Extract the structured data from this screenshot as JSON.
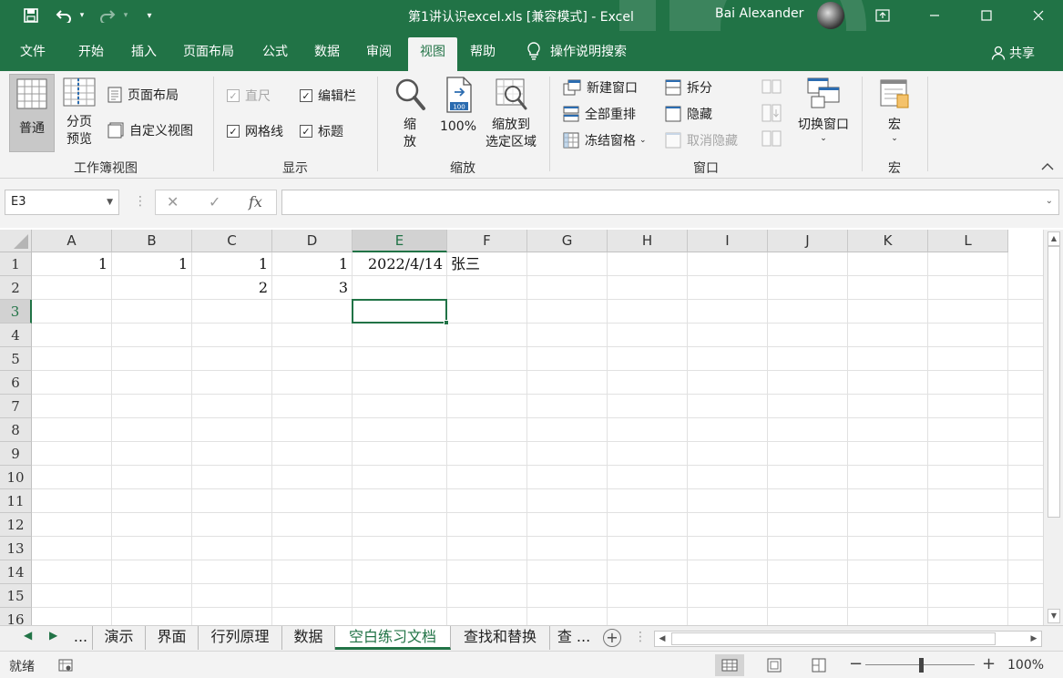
{
  "titlebar": {
    "document_title": "第1讲认识excel.xls  [兼容模式]  -  Excel",
    "user_name": "Bai Alexander",
    "icons": [
      "save-icon",
      "undo-icon",
      "redo-icon",
      "customize-icon",
      "restore-ribbon-icon",
      "minimize-icon",
      "maximize-icon",
      "close-icon"
    ]
  },
  "tabs": {
    "items": [
      "文件",
      "开始",
      "插入",
      "页面布局",
      "公式",
      "数据",
      "审阅",
      "视图",
      "帮助"
    ],
    "active": "视图",
    "tell_me": "操作说明搜索",
    "share": "共享"
  },
  "ribbon": {
    "workbook_views": {
      "label": "工作簿视图",
      "normal": "普通",
      "page_break_1": "分页",
      "page_break_2": "预览",
      "page_layout": "页面布局",
      "custom_views": "自定义视图"
    },
    "show": {
      "label": "显示",
      "ruler": "直尺",
      "formula_bar": "编辑栏",
      "gridlines": "网格线",
      "headings": "标题"
    },
    "zoom": {
      "label": "缩放",
      "zoom_1": "缩",
      "zoom_2": "放",
      "hundred": "100%",
      "zoom_sel_1": "缩放到",
      "zoom_sel_2": "选定区域",
      "icon_number": "100"
    },
    "window": {
      "label": "窗口",
      "new_window": "新建窗口",
      "arrange_all": "全部重排",
      "freeze_panes": "冻结窗格",
      "split": "拆分",
      "hide": "隐藏",
      "unhide": "取消隐藏",
      "switch_windows": "切换窗口"
    },
    "macros": {
      "label": "宏",
      "macros_btn": "宏"
    }
  },
  "formula_bar": {
    "name_box": "E3",
    "cancel": "✕",
    "enter": "✓",
    "fx": "fx",
    "value": ""
  },
  "grid": {
    "columns": [
      "A",
      "B",
      "C",
      "D",
      "E",
      "F",
      "G",
      "H",
      "I",
      "J",
      "K",
      "L"
    ],
    "rows": [
      "1",
      "2",
      "3",
      "4",
      "5",
      "6",
      "7",
      "8",
      "9",
      "10",
      "11",
      "12",
      "13",
      "14",
      "15",
      "16"
    ],
    "selected_cell": "E3",
    "cells": {
      "A1": "1",
      "B1": "1",
      "C1": "1",
      "D1": "1",
      "E1": "2022/4/14",
      "F1": "张三",
      "C2": "2",
      "D2": "3"
    }
  },
  "sheets": {
    "ellipsis": "...",
    "items": [
      "演示",
      "界面",
      "行列原理",
      "数据",
      "空白练习文档",
      "查找和替换",
      "查 ..."
    ],
    "active": "空白练习文档"
  },
  "statusbar": {
    "status": "就绪",
    "zoom": "100%",
    "zoom_minus": "−",
    "zoom_plus": "+"
  },
  "colors": {
    "excel_green": "#217346",
    "ribbon_bg": "#f3f3f3",
    "header_bg": "#e6e6e6"
  }
}
